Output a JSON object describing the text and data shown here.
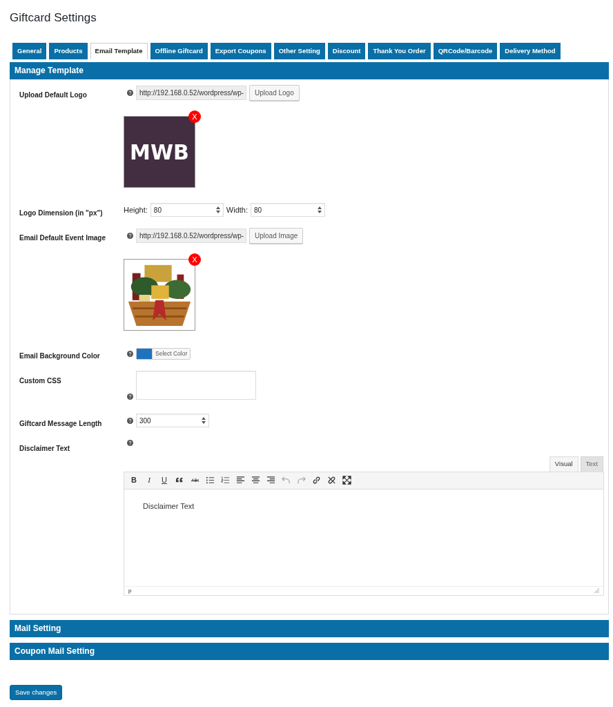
{
  "page_title": "Giftcard Settings",
  "tabs": [
    {
      "label": "General",
      "selected": false
    },
    {
      "label": "Products",
      "selected": false
    },
    {
      "label": "Email Template",
      "selected": true
    },
    {
      "label": "Offline Giftcard",
      "selected": false
    },
    {
      "label": "Export Coupons",
      "selected": false
    },
    {
      "label": "Other Setting",
      "selected": false
    },
    {
      "label": "Discount",
      "selected": false
    },
    {
      "label": "Thank You Order",
      "selected": false
    },
    {
      "label": "QRCode/Barcode",
      "selected": false
    },
    {
      "label": "Delivery Method",
      "selected": false
    }
  ],
  "sections": [
    {
      "title": "Manage Template",
      "fields": [
        {
          "kind": "upload",
          "label": "Upload Default Logo",
          "value": "http://192.168.0.52/wordpress/wp-",
          "button": "Upload Logo",
          "preview": {
            "kind": "logo",
            "logo_text": "MWB"
          },
          "remove": "X"
        },
        {
          "kind": "dimension",
          "label": "Logo Dimension (in \"px\")",
          "parts": [
            {
              "label": "Height:",
              "value": "80"
            },
            {
              "label": "Width:",
              "value": "80"
            }
          ]
        },
        {
          "kind": "upload",
          "label": "Email Default Event Image",
          "value": "http://192.168.0.52/wordpress/wp-",
          "button": "Upload Image",
          "remove": "X"
        },
        {
          "kind": "color",
          "label": "Email Background Color",
          "color": "#1e73be",
          "button": "Select Color"
        },
        {
          "kind": "textarea",
          "label": "Custom CSS"
        },
        {
          "kind": "number",
          "label": "Giftcard Message Length",
          "value": "300"
        },
        {
          "kind": "editor",
          "label": "Disclaimer Text",
          "editor_tabs": [
            {
              "label": "Visual",
              "selected": true
            },
            {
              "label": "Text",
              "selected": false
            }
          ],
          "toolbar": [
            {
              "kind": "bold",
              "text": "B",
              "disabled": false
            },
            {
              "kind": "italic",
              "text": "I",
              "disabled": false
            },
            {
              "kind": "underline",
              "text": "U",
              "disabled": false
            },
            {
              "kind": "quote",
              "disabled": false
            },
            {
              "kind": "strike",
              "disabled": false
            },
            {
              "kind": "ul",
              "disabled": false
            },
            {
              "kind": "ol",
              "disabled": false
            },
            {
              "kind": "alignleft",
              "disabled": false
            },
            {
              "kind": "aligncenter",
              "disabled": false
            },
            {
              "kind": "alignright",
              "disabled": false
            },
            {
              "kind": "undo",
              "disabled": true
            },
            {
              "kind": "redo",
              "disabled": true
            },
            {
              "kind": "link",
              "disabled": false
            },
            {
              "kind": "unlink",
              "disabled": false
            },
            {
              "kind": "fullscreen",
              "disabled": false
            }
          ],
          "content": "Disclaimer Text",
          "path": "p"
        }
      ]
    },
    {
      "title": "Mail Setting"
    },
    {
      "title": "Coupon Mail Setting"
    }
  ],
  "save_button": "Save changes"
}
